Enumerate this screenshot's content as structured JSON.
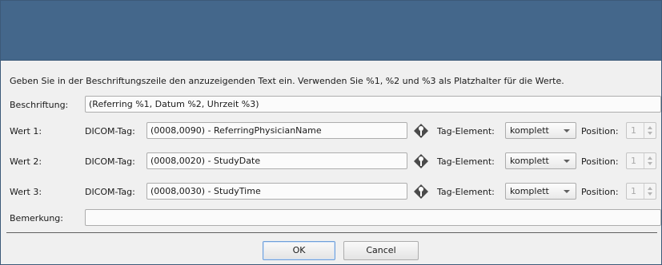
{
  "instruction": "Geben Sie in der Beschriftungszeile den anzuzeigenden Text ein. Verwenden Sie %1, %2 und %3 als Platzhalter für die Werte.",
  "caption": {
    "label": "Beschriftung:",
    "value": "(Referring %1, Datum %2, Uhrzeit %3)"
  },
  "rows": [
    {
      "label": "Wert 1:",
      "dicom_label": "DICOM-Tag:",
      "tag_value": "(0008,0090) - ReferringPhysicianName",
      "element_label": "Tag-Element:",
      "element_value": "komplett",
      "position_label": "Position:",
      "position_value": "1"
    },
    {
      "label": "Wert 2:",
      "dicom_label": "DICOM-Tag:",
      "tag_value": "(0008,0020) - StudyDate",
      "element_label": "Tag-Element:",
      "element_value": "komplett",
      "position_label": "Position:",
      "position_value": "1"
    },
    {
      "label": "Wert 3:",
      "dicom_label": "DICOM-Tag:",
      "tag_value": "(0008,0030) - StudyTime",
      "element_label": "Tag-Element:",
      "element_value": "komplett",
      "position_label": "Position:",
      "position_value": "1"
    }
  ],
  "remark": {
    "label": "Bemerkung:",
    "value": ""
  },
  "buttons": {
    "ok": "OK",
    "cancel": "Cancel"
  },
  "colors": {
    "titlebar": "#44678b",
    "background": "#f0f0f0",
    "picker_icon": "#4a4a4a"
  },
  "icons": {
    "tag_picker": "tag-picker-icon",
    "dropdown": "chevron-down-icon"
  }
}
